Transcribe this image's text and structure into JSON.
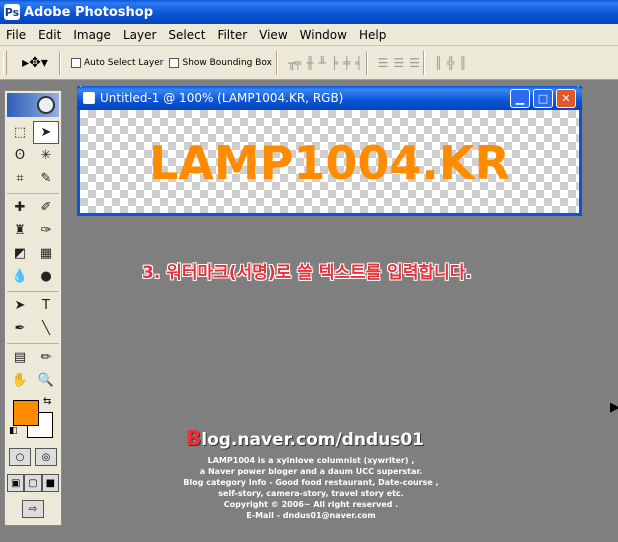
{
  "app": {
    "title": "Adobe Photoshop"
  },
  "menu": [
    "File",
    "Edit",
    "Image",
    "Layer",
    "Select",
    "Filter",
    "View",
    "Window",
    "Help"
  ],
  "options": {
    "auto_select": "Auto Select Layer",
    "show_bounding": "Show Bounding Box"
  },
  "document": {
    "title": "Untitled-1 @ 100% (LAMP1004.KR, RGB)",
    "canvas_text": "LAMP1004.KR",
    "text_color": "#ff8c00"
  },
  "annotation": "3. 워터마크(서명)로 쓸 텍스트를 입력합니다.",
  "watermark": {
    "title_b": "B",
    "title_rest": "log.naver.com/dndus01",
    "lines": [
      "LAMP1004 is a xyinlove columnist (xywriter) ,",
      "a Naver power bloger and a daum UCC superstar.",
      "Blog category  Info - Good food restaurant, Date-course ,",
      "self-story, camera-story, travel story etc.",
      "Copyright © 2006~ All right reserved .",
      "E-Mail - dndus01@naver.com"
    ]
  },
  "colors": {
    "foreground": "#ff8c00",
    "background": "#ffffff"
  }
}
